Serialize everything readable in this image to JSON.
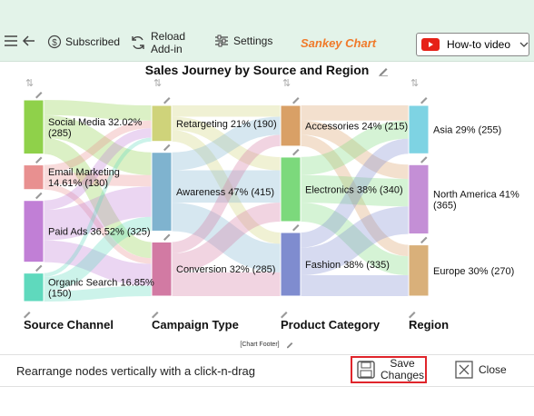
{
  "toolbar": {
    "subscribed_label": "Subscribed",
    "reload_label_1": "Reload",
    "reload_label_2": "Add-in",
    "settings_label": "Settings",
    "app_title": "Sankey Chart",
    "howto_label": "How-to video"
  },
  "chart_data": {
    "type": "sankey",
    "title": "Sales Journey by Source and Region",
    "footer": "[Chart Footer]",
    "stages": [
      "Source Channel",
      "Campaign Type",
      "Product Category",
      "Region"
    ],
    "nodes": [
      {
        "stage": 0,
        "name": "Social Media",
        "pct": "32.02%",
        "value": 285,
        "label_line1": "Social Media 32.02%",
        "label_line2": "(285)",
        "color": "#8fd14a"
      },
      {
        "stage": 0,
        "name": "Email Marketing",
        "pct": "14.61%",
        "value": 130,
        "label_line1": "Email Marketing",
        "label_line2": "14.61% (130)",
        "color": "#e89090"
      },
      {
        "stage": 0,
        "name": "Paid Ads",
        "pct": "36.52%",
        "value": 325,
        "label_line1": "Paid Ads 36.52% (325)",
        "label_line2": "",
        "color": "#c17fd6"
      },
      {
        "stage": 0,
        "name": "Organic Search",
        "pct": "16.85%",
        "value": 150,
        "label_line1": "Organic Search 16.85%",
        "label_line2": "(150)",
        "color": "#5fd9bd"
      },
      {
        "stage": 1,
        "name": "Retargeting",
        "pct": "21%",
        "value": 190,
        "label_line1": "Retargeting 21% (190)",
        "label_line2": "",
        "color": "#cfd37a"
      },
      {
        "stage": 1,
        "name": "Awareness",
        "pct": "47%",
        "value": 415,
        "label_line1": "Awareness 47% (415)",
        "label_line2": "",
        "color": "#7fb3cf"
      },
      {
        "stage": 1,
        "name": "Conversion",
        "pct": "32%",
        "value": 285,
        "label_line1": "Conversion 32% (285)",
        "label_line2": "",
        "color": "#d27aa3"
      },
      {
        "stage": 2,
        "name": "Accessories",
        "pct": "24%",
        "value": 215,
        "label_line1": "Accessories 24% (215)",
        "label_line2": "",
        "color": "#d9a066"
      },
      {
        "stage": 2,
        "name": "Electronics",
        "pct": "38%",
        "value": 340,
        "label_line1": "Electronics 38% (340)",
        "label_line2": "",
        "color": "#7cd97c"
      },
      {
        "stage": 2,
        "name": "Fashion",
        "pct": "38%",
        "value": 335,
        "label_line1": "Fashion 38% (335)",
        "label_line2": "",
        "color": "#7f8ccf"
      },
      {
        "stage": 3,
        "name": "Asia",
        "pct": "29%",
        "value": 255,
        "label_line1": "Asia 29% (255)",
        "label_line2": "",
        "color": "#7ed3e3"
      },
      {
        "stage": 3,
        "name": "North America",
        "pct": "41%",
        "value": 365,
        "label_line1": "North America 41%",
        "label_line2": "(365)",
        "color": "#c48fd6"
      },
      {
        "stage": 3,
        "name": "Europe",
        "pct": "30%",
        "value": 270,
        "label_line1": "Europe 30% (270)",
        "label_line2": "",
        "color": "#d9b07a"
      }
    ],
    "links": [
      {
        "source": 0,
        "target": 4,
        "value": 80
      },
      {
        "source": 0,
        "target": 5,
        "value": 120
      },
      {
        "source": 0,
        "target": 6,
        "value": 85
      },
      {
        "source": 1,
        "target": 4,
        "value": 40
      },
      {
        "source": 1,
        "target": 5,
        "value": 60
      },
      {
        "source": 1,
        "target": 6,
        "value": 30
      },
      {
        "source": 2,
        "target": 4,
        "value": 50
      },
      {
        "source": 2,
        "target": 5,
        "value": 160
      },
      {
        "source": 2,
        "target": 6,
        "value": 115
      },
      {
        "source": 3,
        "target": 4,
        "value": 20
      },
      {
        "source": 3,
        "target": 5,
        "value": 75
      },
      {
        "source": 3,
        "target": 6,
        "value": 55
      },
      {
        "source": 4,
        "target": 7,
        "value": 60
      },
      {
        "source": 4,
        "target": 8,
        "value": 70
      },
      {
        "source": 4,
        "target": 9,
        "value": 60
      },
      {
        "source": 5,
        "target": 7,
        "value": 95
      },
      {
        "source": 5,
        "target": 8,
        "value": 170
      },
      {
        "source": 5,
        "target": 9,
        "value": 150
      },
      {
        "source": 6,
        "target": 7,
        "value": 60
      },
      {
        "source": 6,
        "target": 8,
        "value": 100
      },
      {
        "source": 6,
        "target": 9,
        "value": 125
      },
      {
        "source": 7,
        "target": 10,
        "value": 80
      },
      {
        "source": 7,
        "target": 11,
        "value": 75
      },
      {
        "source": 7,
        "target": 12,
        "value": 60
      },
      {
        "source": 8,
        "target": 10,
        "value": 95
      },
      {
        "source": 8,
        "target": 11,
        "value": 145
      },
      {
        "source": 8,
        "target": 12,
        "value": 100
      },
      {
        "source": 9,
        "target": 10,
        "value": 80
      },
      {
        "source": 9,
        "target": 11,
        "value": 145
      },
      {
        "source": 9,
        "target": 12,
        "value": 110
      }
    ]
  },
  "bottom": {
    "hint": "Rearrange nodes vertically with a click-n-drag",
    "save_line1": "Save",
    "save_line2": "Changes",
    "close_label": "Close"
  }
}
